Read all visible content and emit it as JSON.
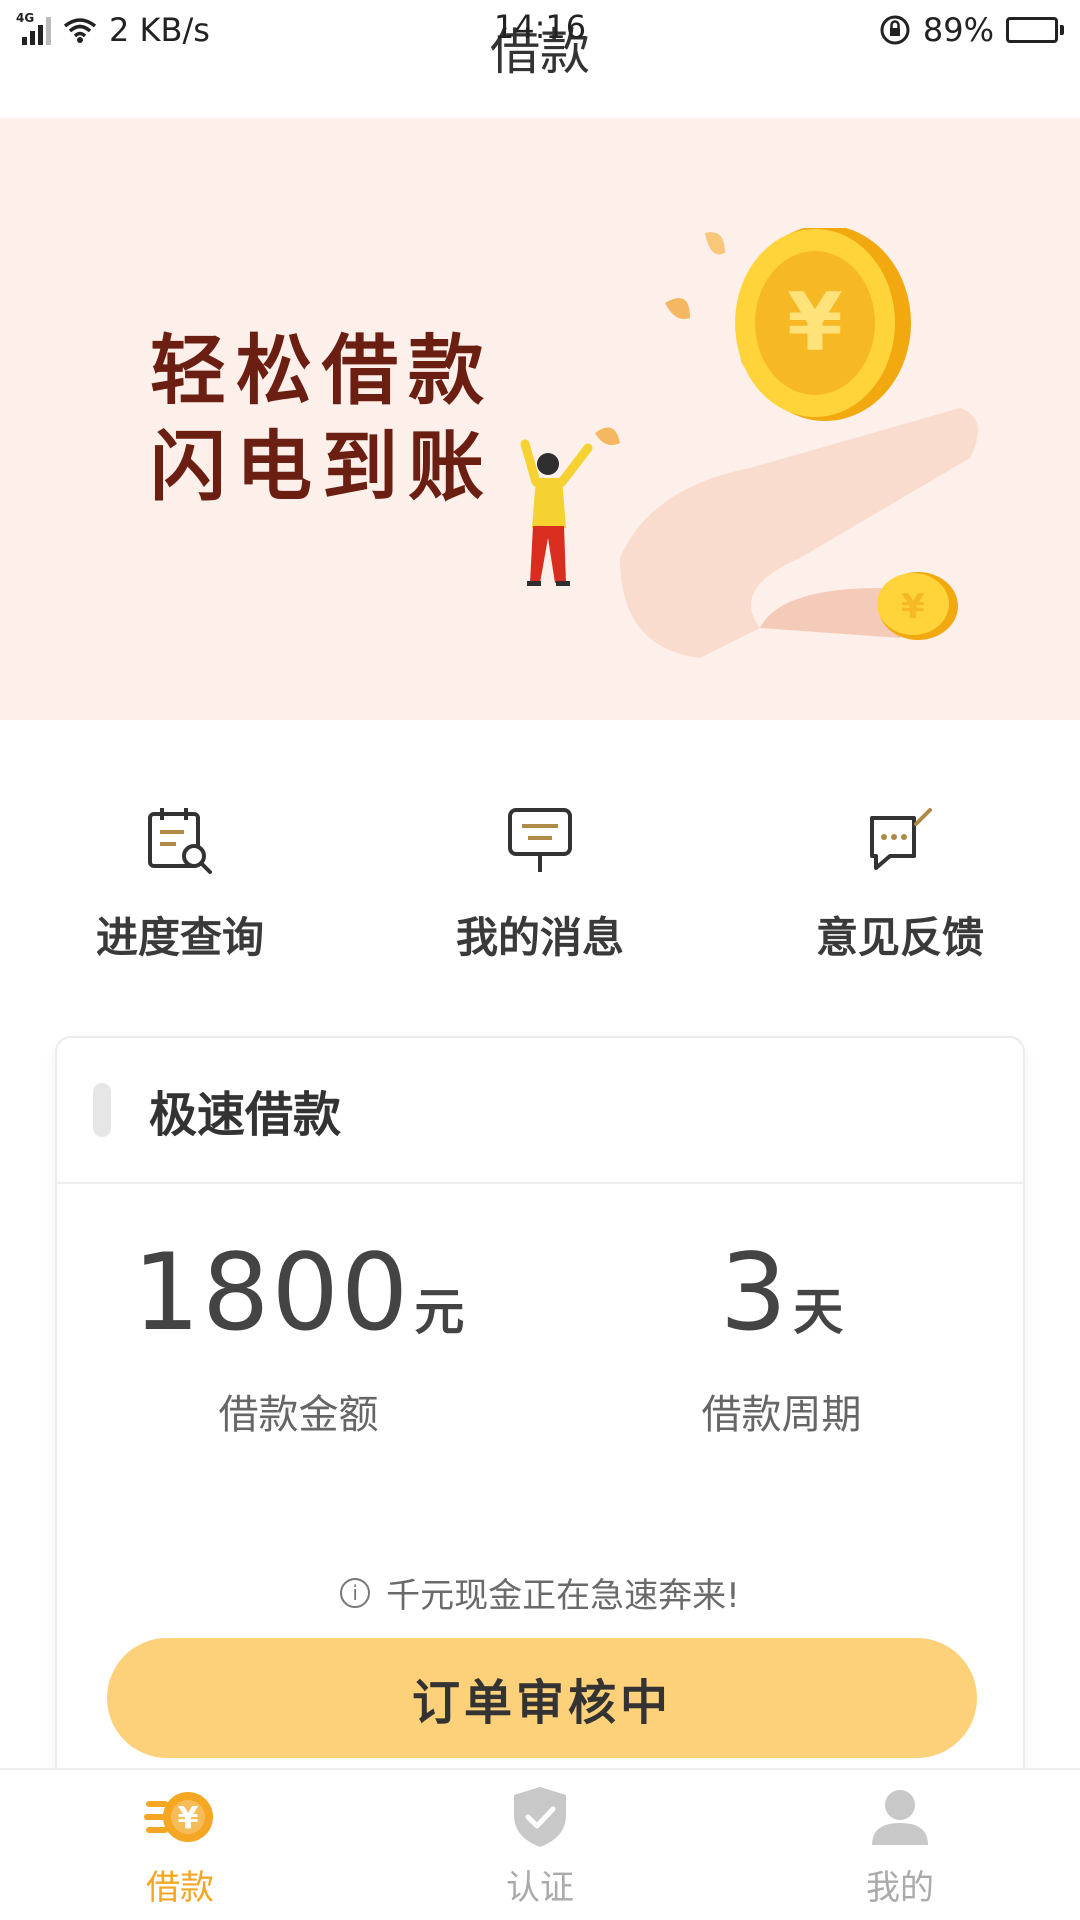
{
  "status_bar": {
    "network": "4G",
    "speed": "2 KB/s",
    "time": "14:16",
    "battery": "89%",
    "battery_level": 0.89
  },
  "header": {
    "title": "借款"
  },
  "banner": {
    "line1": "轻松借款",
    "line2": "闪电到账"
  },
  "quick_actions": [
    {
      "label": "进度查询",
      "icon": "calendar-search-icon"
    },
    {
      "label": "我的消息",
      "icon": "message-board-icon"
    },
    {
      "label": "意见反馈",
      "icon": "feedback-chat-icon"
    }
  ],
  "card": {
    "title": "极速借款",
    "amount": {
      "value": "1800",
      "unit": "元",
      "label": "借款金额"
    },
    "period": {
      "value": "3",
      "unit": "天",
      "label": "借款周期"
    },
    "hint": "千元现金正在急速奔来!",
    "button_label": "订单审核中"
  },
  "bottom_nav": [
    {
      "label": "借款",
      "icon": "yuan-coin-icon",
      "active": true
    },
    {
      "label": "认证",
      "icon": "shield-check-icon",
      "active": false
    },
    {
      "label": "我的",
      "icon": "user-icon",
      "active": false
    }
  ],
  "colors": {
    "accent": "#f5a623",
    "button": "#fdd07a",
    "banner_bg": "#fdf0ea",
    "slogan": "#6b1e12"
  }
}
